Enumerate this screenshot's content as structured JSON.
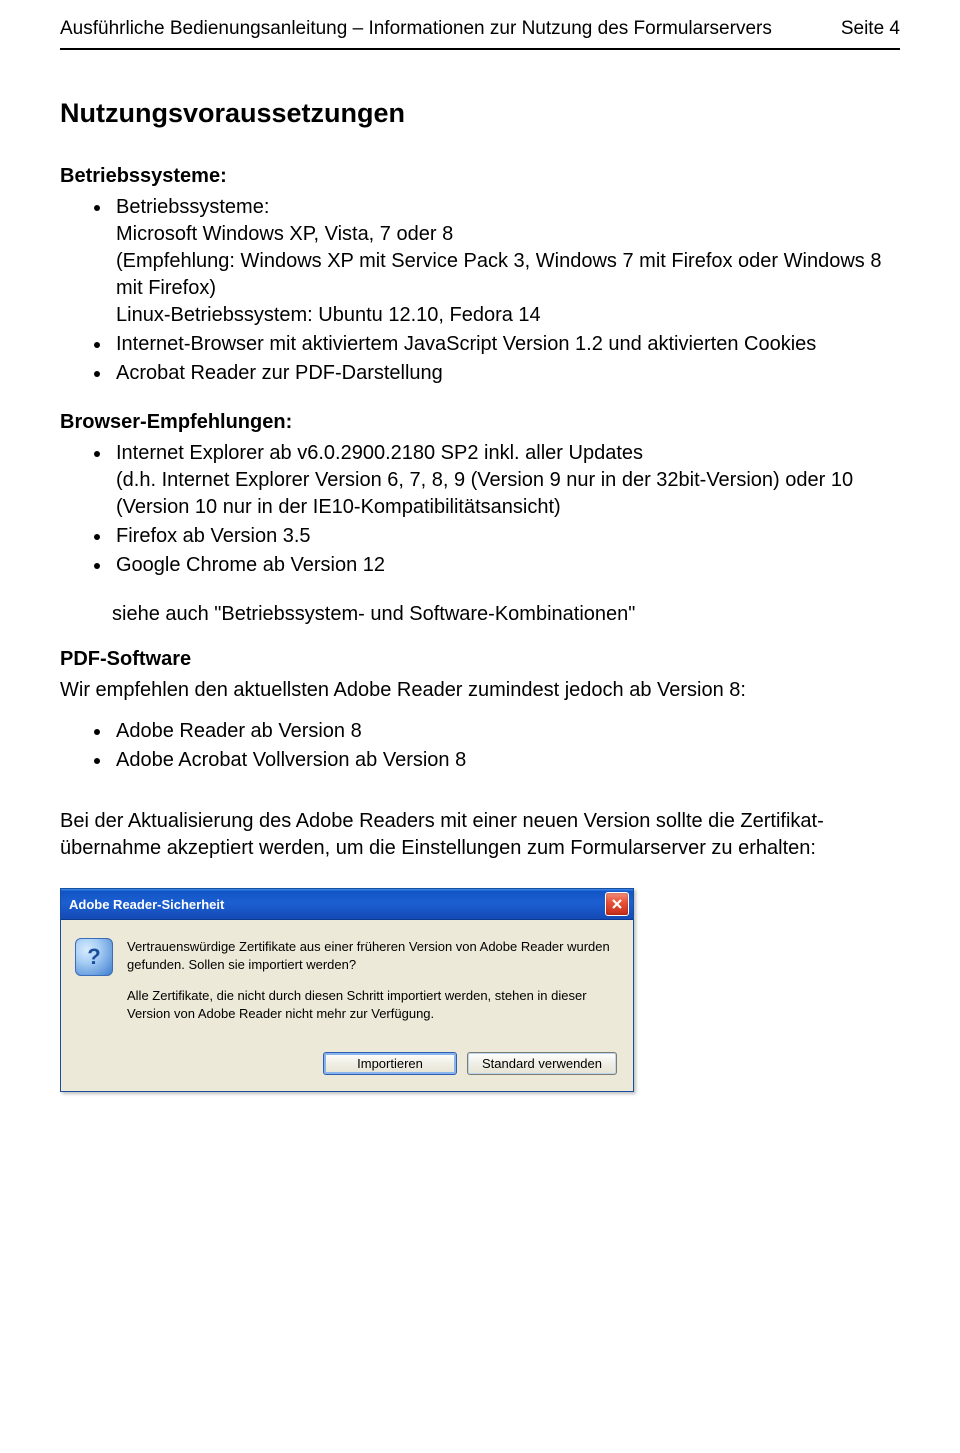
{
  "header": {
    "left": "Ausführliche Bedienungsanleitung – Informationen zur Nutzung des Formularservers",
    "right": "Seite 4"
  },
  "section_title": "Nutzungsvoraussetzungen",
  "os_heading": "Betriebssysteme:",
  "os_items": [
    "Betriebssysteme:\nMicrosoft Windows XP, Vista, 7 oder 8\n(Empfehlung: Windows XP mit Service Pack 3, Windows 7 mit Firefox oder Windows 8 mit Firefox)\nLinux-Betriebssystem: Ubuntu 12.10, Fedora 14",
    "Internet-Browser mit aktiviertem JavaScript Version 1.2 und aktivierten Cookies",
    "Acrobat Reader zur PDF-Darstellung"
  ],
  "browser_heading": "Browser-Empfehlungen:",
  "browser_items": [
    "Internet Explorer ab v6.0.2900.2180 SP2 inkl. aller Updates\n(d.h. Internet Explorer Version 6, 7, 8, 9 (Version 9 nur in der 32bit-Version) oder 10 (Version 10 nur in der IE10-Kompatibilitätsansicht)",
    "Firefox ab Version 3.5",
    "Google Chrome ab Version 12"
  ],
  "see_also": "siehe auch \"Betriebssystem- und Software-Kombinationen\"",
  "pdf_heading": "PDF-Software",
  "pdf_intro": "Wir empfehlen den aktuellsten Adobe Reader zumindest jedoch ab Version 8:",
  "pdf_items": [
    "Adobe Reader ab Version 8",
    "Adobe Acrobat Vollversion ab Version 8"
  ],
  "update_note": "Bei der Aktualisierung des Adobe Readers mit einer neuen Version sollte die Zertifikat­übernahme akzeptiert werden, um die Einstellungen zum Formularserver zu erhalten:",
  "dialog": {
    "title": "Adobe Reader-Sicherheit",
    "line1": "Vertrauenswürdige Zertifikate aus einer früheren Version von Adobe Reader wurden gefunden. Sollen sie importiert werden?",
    "line2": "Alle Zertifikate, die nicht durch diesen Schritt importiert werden, stehen in dieser Version von Adobe Reader nicht mehr zur Verfügung.",
    "btn_import": "Importieren",
    "btn_default": "Standard verwenden"
  }
}
